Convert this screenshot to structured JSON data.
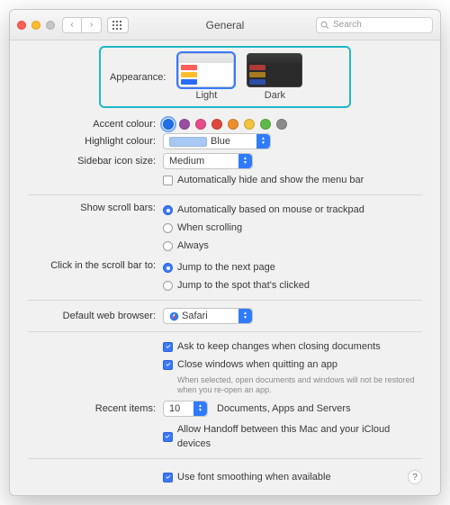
{
  "window": {
    "title": "General"
  },
  "search": {
    "placeholder": "Search"
  },
  "appearance": {
    "label": "Appearance:",
    "options": {
      "light": "Light",
      "dark": "Dark"
    }
  },
  "accent": {
    "label": "Accent colour:",
    "colors": [
      "#1f6fe8",
      "#9a4da0",
      "#e84b8a",
      "#e0483d",
      "#ec8f2c",
      "#f0c43b",
      "#5fb84a",
      "#8b8b8b"
    ],
    "selected": 0
  },
  "highlight": {
    "label": "Highlight colour:",
    "value": "Blue"
  },
  "sidebar_size": {
    "label": "Sidebar icon size:",
    "value": "Medium"
  },
  "auto_hide_menubar": {
    "label": "Automatically hide and show the menu bar",
    "checked": false
  },
  "scrollbars": {
    "label": "Show scroll bars:",
    "options": [
      "Automatically based on mouse or trackpad",
      "When scrolling",
      "Always"
    ],
    "selected": 0
  },
  "scrollclick": {
    "label": "Click in the scroll bar to:",
    "options": [
      "Jump to the next page",
      "Jump to the spot that's clicked"
    ],
    "selected": 0
  },
  "browser": {
    "label": "Default web browser:",
    "value": "Safari"
  },
  "ask_keep": {
    "label": "Ask to keep changes when closing documents"
  },
  "close_windows": {
    "label": "Close windows when quitting an app",
    "sub": "When selected, open documents and windows will not be restored when you re-open an app."
  },
  "recent": {
    "label": "Recent items:",
    "value": "10",
    "suffix": "Documents, Apps and Servers"
  },
  "handoff": {
    "label": "Allow Handoff between this Mac and your iCloud devices"
  },
  "fontsmoothing": {
    "label": "Use font smoothing when available"
  }
}
